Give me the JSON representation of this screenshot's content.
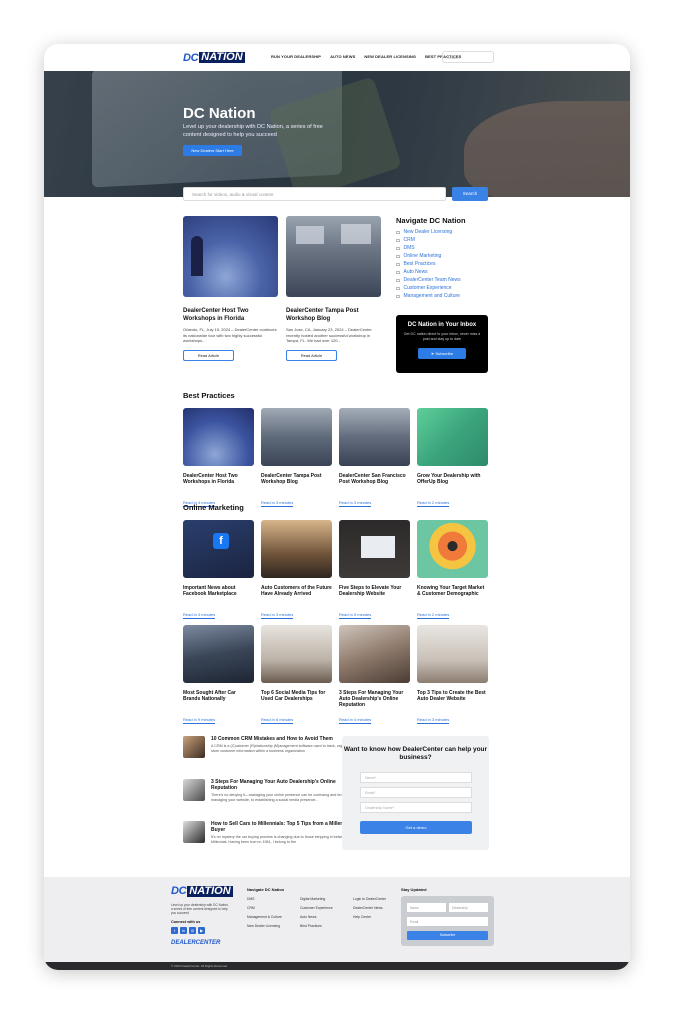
{
  "header": {
    "logo_dc": "DC",
    "logo_nation": "NATION",
    "nav": [
      "RUN YOUR DEALERSHIP",
      "AUTO NEWS",
      "NEW DEALER LICENSING",
      "BEST PRACTICES"
    ],
    "search_placeholder": "Search"
  },
  "hero": {
    "title": "DC Nation",
    "subtitle": "Level up your dealership with DC Nation, a series of free content designed to help you succeed",
    "button": "New Dealers Start Here",
    "search_placeholder": "Search for videos, audio & visual content",
    "search_button": "Search"
  },
  "featured": [
    {
      "title": "DealerCenter Host Two Workshops in Florida",
      "excerpt": "Orlando, FL, July 15, 2024 – DealerCenter continues its nationwide tour with two highly successful workshops...",
      "button": "Read Article"
    },
    {
      "title": "DealerCenter Tampa Post Workshop Blog",
      "excerpt": "San Jose, CA, January 23, 2024 – DealerCenter recently hosted another successful workshop in Tampa, FL. We had over 120...",
      "button": "Read Article"
    }
  ],
  "navigate": {
    "title": "Navigate DC Nation",
    "items": [
      "New Dealer Licensing",
      "CRM",
      "DMS",
      "Online Marketing",
      "Best Practices",
      "Auto News",
      "DealerCenter Team News",
      "Customer Experience",
      "Management and Culture"
    ]
  },
  "inbox": {
    "title": "DC Nation in Your Inbox",
    "text": "Get DC nation direct to your inbox, never miss a post and stay up to date",
    "button": "Subscribe"
  },
  "best_practices": {
    "heading": "Best Practices",
    "cards": [
      {
        "title": "DealerCenter Host Two Workshops in Florida",
        "read": "Read in 4 minutes"
      },
      {
        "title": "DealerCenter Tampa Post Workshop Blog",
        "read": "Read in 3 minutes"
      },
      {
        "title": "DealerCenter San Francisco Post Workshop Blog",
        "read": "Read in 3 minutes"
      },
      {
        "title": "Grow Your Dealership with OfferUp Blog",
        "read": "Read in 2 minutes"
      }
    ]
  },
  "online_marketing": {
    "heading": "Online Marketing",
    "cards": [
      {
        "title": "Important News about Facebook Marketplace",
        "read": "Read in 3 minutes"
      },
      {
        "title": "Auto Customers of the Future Have Already Arrived",
        "read": "Read in 3 minutes"
      },
      {
        "title": "Five Steps to Elevate Your Dealership Website",
        "read": "Read in 5 minutes"
      },
      {
        "title": "Knowing Your Target Market & Customer Demographic",
        "read": "Read in 2 minutes"
      },
      {
        "title": "Most Sought After Car Brands Nationally",
        "read": "Read in 9 minutes"
      },
      {
        "title": "Top 6 Social Media Tips for Used Car Dealerships",
        "read": "Read in 6 minutes"
      },
      {
        "title": "3 Steps For Managing Your Auto Dealership's Online Reputation",
        "read": "Read in 4 minutes"
      },
      {
        "title": "Top 3 Tips to Create the Best Auto Dealer Website",
        "read": "Read in 3 minutes"
      }
    ]
  },
  "compact": [
    {
      "title": "10 Common CRM Mistakes and How to Avoid Them",
      "excerpt": "A CRM is a (C)ustomer (R)elationship (M)anagement software used to track, organize, and store customer information within a business organization"
    },
    {
      "title": "3 Steps For Managing Your Auto Dealership's Online Reputation",
      "excerpt": "There's no denying it—managing your online presence can be confusing and tedious. From managing your website, to establishing a social media presence..."
    },
    {
      "title": "How to Sell Cars to Millennials: Top 5 Tips from a Millennial Buyer",
      "excerpt": "It's no mystery the car buying process is changing due to those stepping in between '18 '9% - Millennial. Having been born in 1981, I belong to the"
    }
  ],
  "contact": {
    "title": "Want to know how DealerCenter can help your business?",
    "fields": [
      "Name*",
      "Email*",
      "Dealership Name*"
    ],
    "button": "Get a demo"
  },
  "footer": {
    "tagline": "Level up your dealership with DC Nation, a series of free content designed to help you succeed",
    "connect": "Connect with us",
    "social": [
      "f",
      "in",
      "◎",
      "▶"
    ],
    "dealercenter": "DEALERCENTER",
    "nav_title": "Navigate DC Nation",
    "col1": [
      "DMS",
      "CRM",
      "Management & Culture",
      "New Dealer Licensing"
    ],
    "col2": [
      "Digital Marketing",
      "Customer Experience",
      "Auto News",
      "Best Practices"
    ],
    "col3": [
      "Login to DealerCenter",
      "DealerCenter News",
      "Help Center"
    ],
    "stay_title": "Stay Updated",
    "stay_first": "Name",
    "stay_last": "Dealership",
    "stay_email": "Email",
    "stay_btn": "Subscribe",
    "copyright": "© 2024 DealerCenter. All Rights Reserved."
  }
}
